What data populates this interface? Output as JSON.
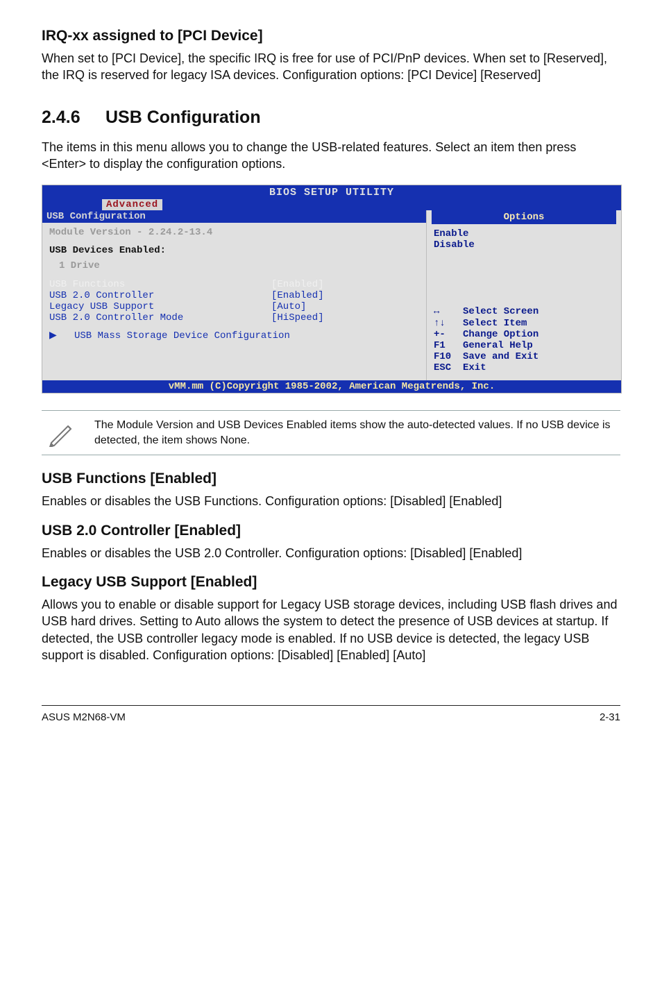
{
  "irq": {
    "title": "IRQ-xx assigned to [PCI Device]",
    "body": "When set to [PCI Device], the specific IRQ is free for use of PCI/PnP devices. When set to [Reserved], the IRQ is reserved for legacy ISA devices. Configuration options: [PCI Device] [Reserved]"
  },
  "chapter": {
    "num": "2.4.6",
    "title": "USB Configuration",
    "intro": "The items in this menu allows you to change the USB-related features. Select an item then press <Enter> to display the configuration options."
  },
  "bios": {
    "header_title": "BIOS SETUP UTILITY",
    "tab": "Advanced",
    "panel_title": "USB Configuration",
    "module_line": "Module Version - 2.24.2-13.4",
    "devices_header": "USB Devices Enabled:",
    "devices_value": "1 Drive",
    "rows": [
      {
        "key": "USB Functions",
        "value": "[Enabled]",
        "selected": true
      },
      {
        "key": "USB 2.0 Controller",
        "value": "[Enabled]",
        "selected": false
      },
      {
        "key": "Legacy USB Support",
        "value": "[Auto]",
        "selected": false
      },
      {
        "key": "USB 2.0 Controller Mode",
        "value": "[HiSpeed]",
        "selected": false
      }
    ],
    "submenu_marker": "▶",
    "submenu_label": "USB Mass Storage Device Configuration",
    "options_title": "Options",
    "options": [
      "Enable",
      "Disable"
    ],
    "controls": [
      {
        "sym": "↔",
        "label": "Select Screen"
      },
      {
        "sym": "↑↓",
        "label": "Select Item"
      },
      {
        "sym": "+-",
        "label": "Change Option"
      },
      {
        "sym": "F1",
        "label": "General Help"
      },
      {
        "sym": "F10",
        "label": "Save and Exit"
      },
      {
        "sym": "ESC",
        "label": "Exit"
      }
    ],
    "copyright": "vMM.mm (C)Copyright 1985-2002, American Megatrends, Inc."
  },
  "note": {
    "text": "The Module Version and USB Devices Enabled items show the auto-detected values. If no USB device is detected, the item shows None."
  },
  "usb_functions": {
    "title": "USB Functions [Enabled]",
    "body": "Enables or disables the USB Functions. Configuration options: [Disabled] [Enabled]"
  },
  "usb20": {
    "title": "USB 2.0 Controller [Enabled]",
    "body": "Enables or disables the USB 2.0 Controller. Configuration options: [Disabled] [Enabled]"
  },
  "legacy": {
    "title": "Legacy USB Support [Enabled]",
    "body": "Allows you to enable or disable support for Legacy USB storage devices, including USB flash drives and USB hard drives. Setting to Auto allows the system to detect the presence of USB devices at startup. If detected, the USB controller legacy mode is enabled. If no USB device is detected, the legacy USB support is disabled. Configuration options: [Disabled] [Enabled] [Auto]"
  },
  "footer": {
    "left": "ASUS M2N68-VM",
    "right": "2-31"
  }
}
